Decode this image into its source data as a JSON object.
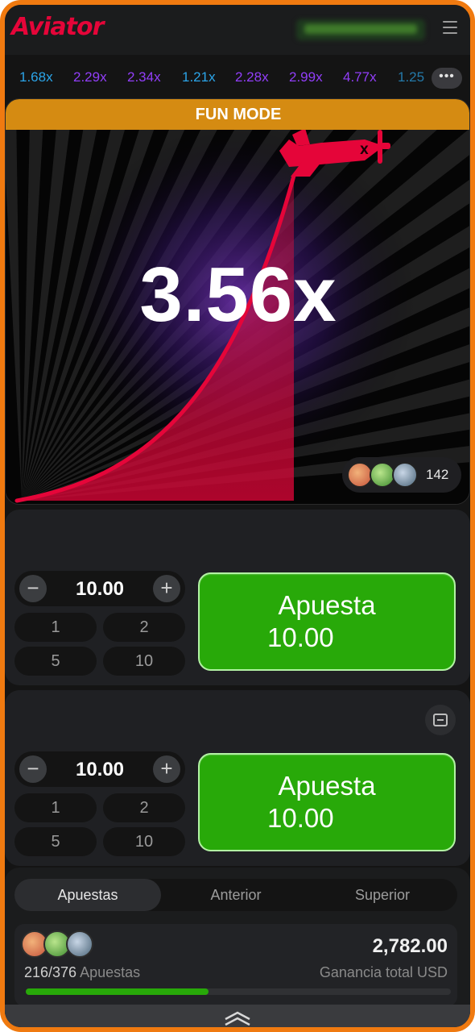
{
  "header": {
    "logo": "Aviator",
    "menu_icon": "hamburger-menu-icon"
  },
  "history": {
    "items": [
      {
        "value": "1.68x",
        "color": "#2ba4e8"
      },
      {
        "value": "2.29x",
        "color": "#913ef8"
      },
      {
        "value": "2.34x",
        "color": "#913ef8"
      },
      {
        "value": "1.21x",
        "color": "#2ba4e8"
      },
      {
        "value": "2.28x",
        "color": "#913ef8"
      },
      {
        "value": "2.99x",
        "color": "#913ef8"
      },
      {
        "value": "4.77x",
        "color": "#913ef8"
      },
      {
        "value": "1.25",
        "color": "#2ba4e8"
      }
    ],
    "more_label": "•••"
  },
  "game": {
    "mode_label": "FUN MODE",
    "multiplier": "3.56x",
    "players_count": "142",
    "curve_color": "#e50539",
    "plane_color": "#e50539"
  },
  "bets": [
    {
      "amount": "10.00",
      "minus": "−",
      "plus": "+",
      "quick": [
        "1",
        "2",
        "5",
        "10"
      ],
      "button_title": "Apuesta",
      "button_amount": "10.00"
    },
    {
      "amount": "10.00",
      "minus": "−",
      "plus": "+",
      "quick": [
        "1",
        "2",
        "5",
        "10"
      ],
      "button_title": "Apuesta",
      "button_amount": "10.00"
    }
  ],
  "all_bets": {
    "tabs": [
      "Apuestas",
      "Anterior",
      "Superior"
    ],
    "active_tab": "Apuestas",
    "total_win": "2,782.00",
    "bets_count": "216/376",
    "bets_label": "Apuestas",
    "total_caption": "Ganancia total USD",
    "progress": 0.43
  },
  "colors": {
    "accent_green": "#28a909",
    "fun_mode": "#d58b12",
    "frame": "#f07a10"
  }
}
